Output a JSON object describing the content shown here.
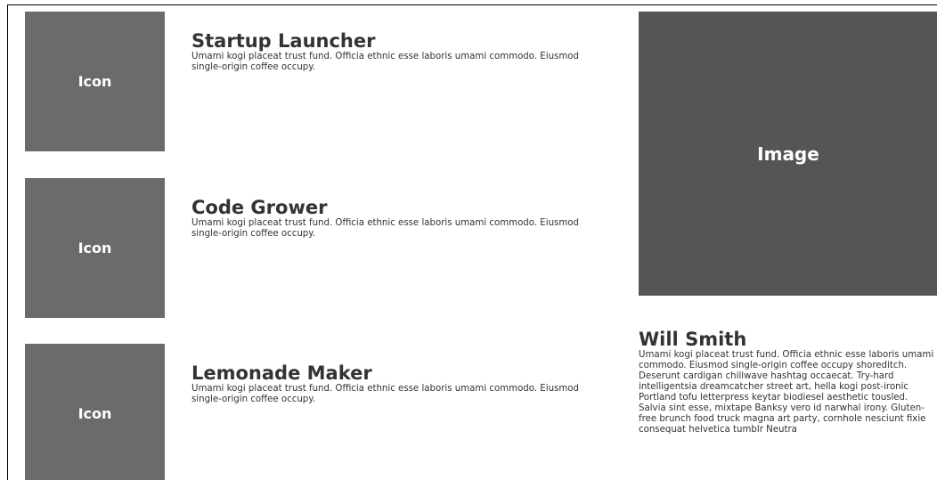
{
  "features": [
    {
      "icon_label": "Icon",
      "title": "Startup Launcher",
      "description": "Umami kogi placeat trust fund. Officia ethnic esse laboris umami commodo. Eiusmod single-origin coffee occupy."
    },
    {
      "icon_label": "Icon",
      "title": "Code Grower",
      "description": "Umami kogi placeat trust fund. Officia ethnic esse laboris umami commodo. Eiusmod single-origin coffee occupy."
    },
    {
      "icon_label": "Icon",
      "title": "Lemonade Maker",
      "description": "Umami kogi placeat trust fund. Officia ethnic esse laboris umami commodo. Eiusmod single-origin coffee occupy."
    }
  ],
  "image": {
    "label": "Image"
  },
  "profile": {
    "name": "Will Smith",
    "bio": "Umami kogi placeat trust fund. Officia ethnic esse laboris umami commodo. Eiusmod single-origin coffee occupy shoreditch. Deserunt cardigan chillwave hashtag occaecat. Try-hard intelligentsia dreamcatcher street art, hella kogi post-ironic Portland tofu letterpress keytar biodiesel aesthetic tousled. Salvia sint esse, mixtape Banksy vero id narwhal irony. Gluten-free brunch food truck magna art party, cornhole nesciunt fixie consequat helvetica tumblr Neutra"
  },
  "colors": {
    "icon_placeholder": "#6b6b6b",
    "image_placeholder": "#555555",
    "text": "#333333",
    "placeholder_text": "#ffffff"
  }
}
